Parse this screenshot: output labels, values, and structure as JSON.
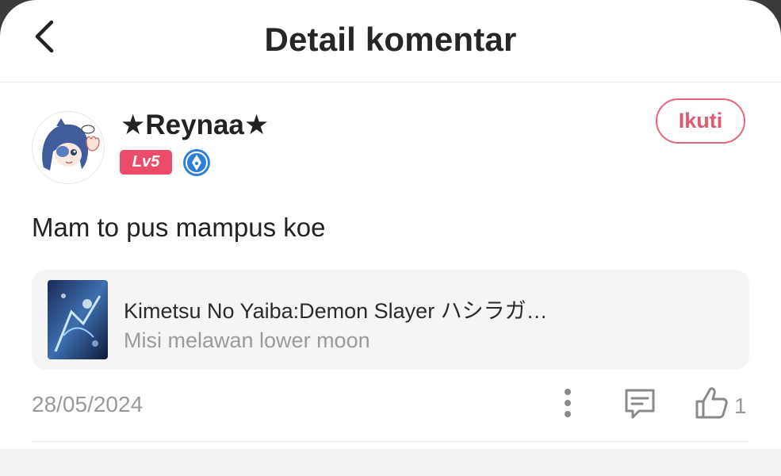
{
  "header": {
    "title": "Detail komentar",
    "back_icon": "chevron-left-icon"
  },
  "comment": {
    "username": "★Reynaa★",
    "level_badge": "Lv5",
    "level_badge_color": "#ea4c6a",
    "medal_icon": "pen-nib-medal-icon",
    "follow_label": "Ikuti",
    "accent_color": "#e8637c",
    "text": "Mam to pus mampus koe",
    "date": "28/05/2024",
    "like_count": "1"
  },
  "linked_post": {
    "title": "Kimetsu No Yaiba:Demon Slayer ハシラガ…",
    "subtitle": "Misi melawan lower moon"
  },
  "actions": {
    "more_icon": "more-vertical-icon",
    "reply_icon": "comment-icon",
    "like_icon": "thumbs-up-icon"
  }
}
